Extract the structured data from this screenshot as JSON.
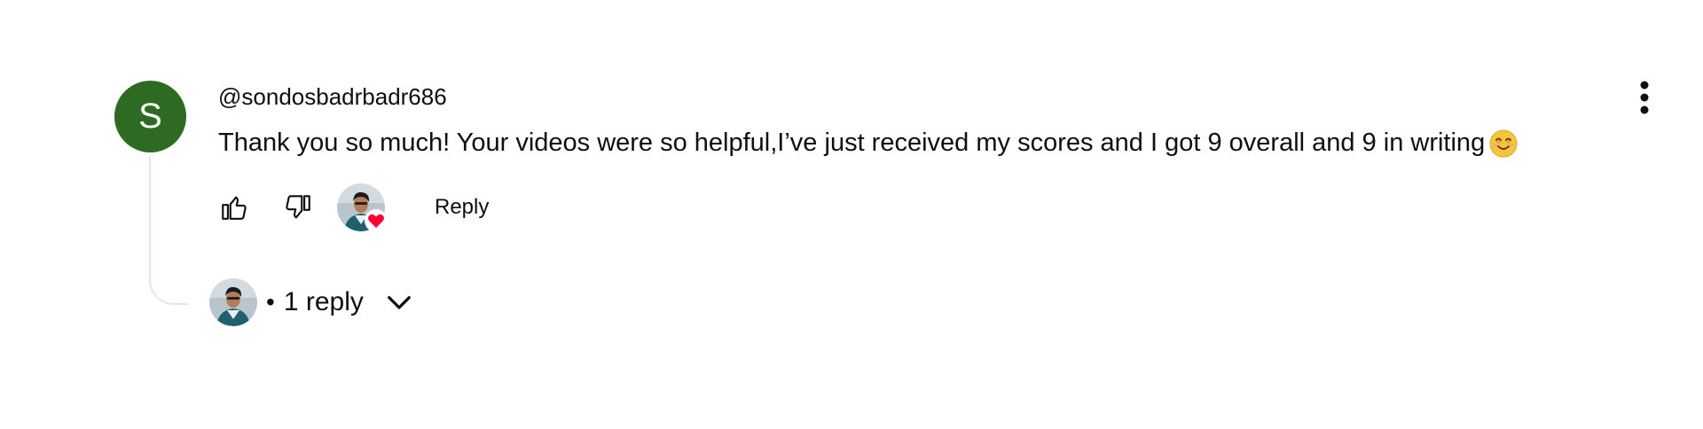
{
  "comment": {
    "avatar_letter": "S",
    "avatar_color": "#2d6b22",
    "author": "@sondosbadrbadr686",
    "text": "Thank you so much!  Your videos were so helpful,I’ve just received my scores and I got 9 overall and 9 in writing",
    "emoji": "smiling-face-emoji"
  },
  "actions": {
    "like_icon": "thumbs-up-icon",
    "dislike_icon": "thumbs-down-icon",
    "creator_heart": "creator-heart-avatar",
    "reply_label": "Reply"
  },
  "replies": {
    "count_label": "1 reply",
    "separator": "•",
    "expand_icon": "chevron-down-icon"
  },
  "menu": {
    "icon": "more-vert-icon"
  },
  "colors": {
    "text": "#0f0f0f",
    "heart": "#ff0033",
    "thread_line": "#e5e5e5"
  }
}
